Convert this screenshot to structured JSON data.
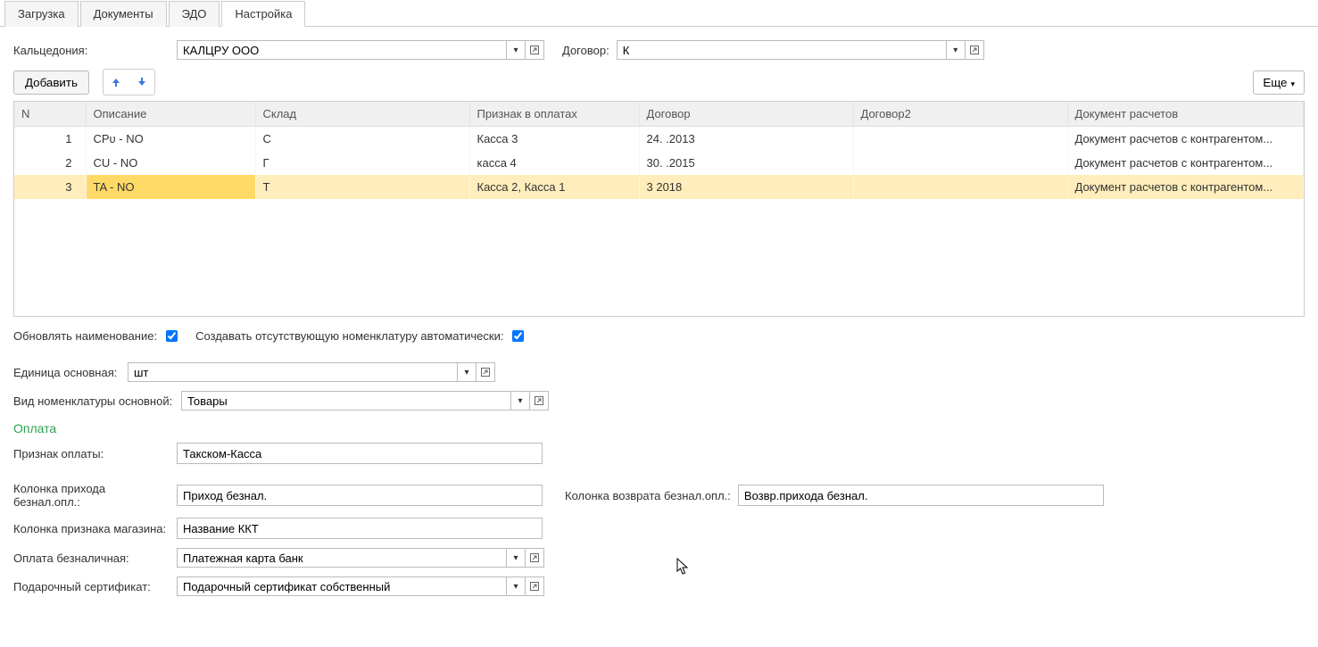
{
  "tabs": [
    {
      "label": "Загрузка",
      "active": false
    },
    {
      "label": "Документы",
      "active": false
    },
    {
      "label": "ЭДО",
      "active": false
    },
    {
      "label": "Настройка",
      "active": true
    }
  ],
  "header": {
    "label_kalts": "Кальцедония:",
    "value_kalts": "КАЛЦРУ ООО",
    "label_dogovor": "Договор:",
    "value_dogovor": "К"
  },
  "toolbar": {
    "add_label": "Добавить",
    "more_label": "Еще"
  },
  "table": {
    "headers": {
      "n": "N",
      "desc": "Описание",
      "sklad": "Склад",
      "priznak": "Признак в оплатах",
      "dogovor": "Договор",
      "dogovor2": "Договор2",
      "doc": "Документ расчетов"
    },
    "rows": [
      {
        "n": "1",
        "desc": "CPᴜ   - NO",
        "sklad": "С",
        "priznak": "Касса 3",
        "dogovor": "24.          .2013",
        "dogovor2": "",
        "doc": "Документ расчетов с контрагентом...",
        "selected": false
      },
      {
        "n": "2",
        "desc": "CU   - NO",
        "sklad": "Г",
        "priznak": "касса 4",
        "dogovor": "30.          .2015",
        "dogovor2": "",
        "doc": "Документ расчетов с контрагентом...",
        "selected": false
      },
      {
        "n": "3",
        "desc": "TA   - NO",
        "sklad": "Т",
        "priznak": "Касса 2, Касса 1",
        "dogovor": "3            2018",
        "dogovor2": "",
        "doc": "Документ расчетов с контрагентом...",
        "selected": true
      }
    ]
  },
  "checkboxes": {
    "update_name_label": "Обновлять наименование:",
    "update_name_checked": true,
    "auto_create_label": "Создавать отсутствующую номенклатуру автоматически:",
    "auto_create_checked": true
  },
  "fields": {
    "unit_label": "Единица основная:",
    "unit_value": "шт",
    "nomtype_label": "Вид номенклатуры основной:",
    "nomtype_value": "Товары"
  },
  "section_payment": "Оплата",
  "payment": {
    "priznak_label": "Признак оплаты:",
    "priznak_value": "Такском-Касса",
    "col_in_label": "Колонка прихода безнал.опл.:",
    "col_in_value": "Приход безнал.",
    "col_ret_label": "Колонка возврата безнал.опл.:",
    "col_ret_value": "Возвр.прихода безнал.",
    "col_mag_label": "Колонка признака магазина:",
    "col_mag_value": "Название ККТ",
    "pay_bn_label": "Оплата безналичная:",
    "pay_bn_value": "Платежная карта банк",
    "cert_label": "Подарочный сертификат:",
    "cert_value": "Подарочный сертификат собственный"
  }
}
